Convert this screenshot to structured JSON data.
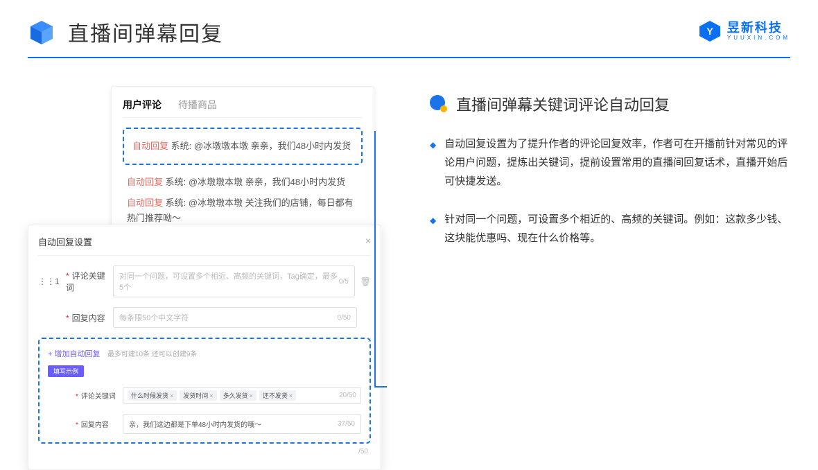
{
  "header": {
    "title": "直播间弹幕回复"
  },
  "logo": {
    "main": "昱新科技",
    "sub": "YUUXIN.COM"
  },
  "card1": {
    "tabs": {
      "active": "用户评论",
      "inactive": "待播商品"
    },
    "highlight": {
      "tag": "自动回复",
      "text": " 系统: @冰墩墩本墩 亲亲，我们48小时内发货"
    },
    "line2": {
      "tag": "自动回复",
      "text": " 系统: @冰墩墩本墩 亲亲，我们48小时内发货"
    },
    "line3": {
      "tag": "自动回复",
      "text": " 系统: @冰墩墩本墩 关注我们的店铺，每日都有热门推荐呦～"
    }
  },
  "card2": {
    "title": "自动回复设置",
    "close": "×",
    "idx": "1",
    "row1": {
      "label": "评论关键词",
      "placeholder": "对同一个问题，可设置多个相近、高频的关键词，Tag确定，最多5个",
      "counter": "0/5"
    },
    "row2": {
      "label": "回复内容",
      "placeholder": "每条限50个中文字符",
      "counter": "0/50"
    },
    "add": {
      "text": "+ 增加自动回复",
      "hint": "最多可建10条 还可以创建9条"
    },
    "example": "填写示例",
    "ex_row1": {
      "label": "评论关键词",
      "tags": [
        "什么时候发货",
        "发货时间",
        "多久发货",
        "还不发货"
      ],
      "counter": "20/50"
    },
    "ex_row2": {
      "label": "回复内容",
      "text": "亲，我们这边都是下单48小时内发货的哦～",
      "counter": "37/50"
    },
    "bottom_counter": "/50"
  },
  "right": {
    "title": "直播间弹幕关键词评论自动回复",
    "bullet1": "自动回复设置为了提升作者的评论回复效率，作者可在开播前针对常见的评论用户问题，提炼出关键词，提前设置常用的直播间回复话术，直播开始后可快捷发送。",
    "bullet2": "针对同一个问题，可设置多个相近的、高频的关键词。例如：这款多少钱、这块能优惠吗、现在什么价格等。"
  }
}
